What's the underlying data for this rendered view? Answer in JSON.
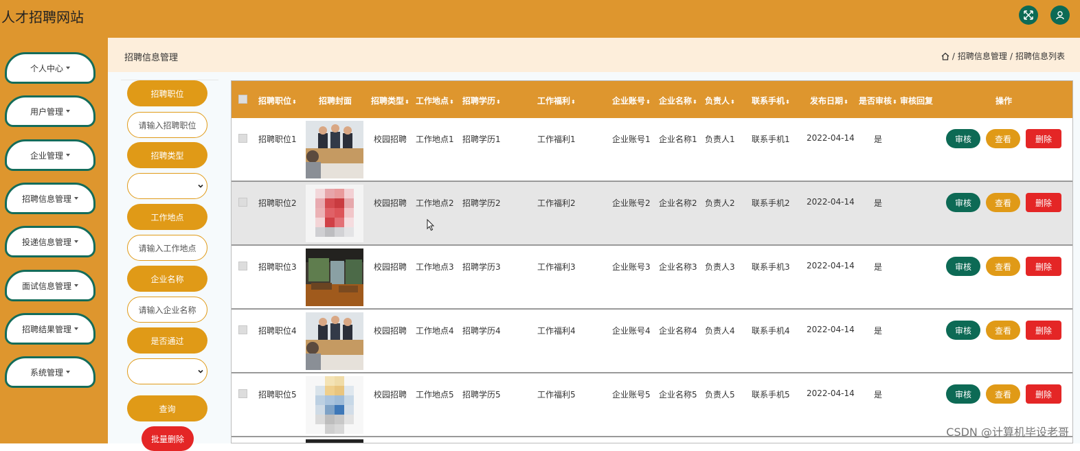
{
  "app": {
    "title": "人才招聘网站"
  },
  "top_icons": [
    "fullscreen-icon",
    "user-icon"
  ],
  "sidebar": {
    "items": [
      {
        "label": "个人中心"
      },
      {
        "label": "用户管理"
      },
      {
        "label": "企业管理"
      },
      {
        "label": "招聘信息管理"
      },
      {
        "label": "投递信息管理"
      },
      {
        "label": "面试信息管理"
      },
      {
        "label": "招聘结果管理"
      },
      {
        "label": "系统管理"
      }
    ]
  },
  "header": {
    "title": "招聘信息管理",
    "breadcrumb": [
      "招聘信息管理",
      "招聘信息列表"
    ]
  },
  "filters": {
    "position_label": "招聘职位",
    "position_placeholder": "请输入招聘职位",
    "type_label": "招聘类型",
    "type_value": "",
    "location_label": "工作地点",
    "location_placeholder": "请输入工作地点",
    "company_label": "企业名称",
    "company_placeholder": "请输入企业名称",
    "approved_label": "是否通过",
    "approved_value": "",
    "search_label": "查询",
    "batch_delete_label": "批量删除"
  },
  "table": {
    "columns": [
      "招聘职位",
      "招聘封面",
      "招聘类型",
      "工作地点",
      "招聘学历",
      "工作福利",
      "企业账号",
      "企业名称",
      "负责人",
      "联系手机",
      "发布日期",
      "是否审核",
      "审核回复",
      "操作"
    ],
    "actions": {
      "review": "审核",
      "view": "查看",
      "delete": "删除"
    },
    "rows": [
      {
        "position": "招聘职位1",
        "cover": "interview-photo",
        "type": "校园招聘",
        "location": "工作地点1",
        "education": "招聘学历1",
        "welfare": "工作福利1",
        "account": "企业账号1",
        "company": "企业名称1",
        "contact": "负责人1",
        "phone": "联系手机1",
        "date": "2022-04-14",
        "audited": "是",
        "reply": ""
      },
      {
        "position": "招聘职位2",
        "cover": "pixelated-red",
        "type": "校园招聘",
        "location": "工作地点2",
        "education": "招聘学历2",
        "welfare": "工作福利2",
        "account": "企业账号2",
        "company": "企业名称2",
        "contact": "负责人2",
        "phone": "联系手机2",
        "date": "2022-04-14",
        "audited": "是",
        "reply": ""
      },
      {
        "position": "招聘职位3",
        "cover": "office-photo",
        "type": "校园招聘",
        "location": "工作地点3",
        "education": "招聘学历3",
        "welfare": "工作福利3",
        "account": "企业账号3",
        "company": "企业名称3",
        "contact": "负责人3",
        "phone": "联系手机3",
        "date": "2022-04-14",
        "audited": "是",
        "reply": ""
      },
      {
        "position": "招聘职位4",
        "cover": "interview-photo",
        "type": "校园招聘",
        "location": "工作地点4",
        "education": "招聘学历4",
        "welfare": "工作福利4",
        "account": "企业账号4",
        "company": "企业名称4",
        "contact": "负责人4",
        "phone": "联系手机4",
        "date": "2022-04-14",
        "audited": "是",
        "reply": ""
      },
      {
        "position": "招聘职位5",
        "cover": "pixelated-blue",
        "type": "校园招聘",
        "location": "工作地点5",
        "education": "招聘学历5",
        "welfare": "工作福利5",
        "account": "企业账号5",
        "company": "企业名称5",
        "contact": "负责人5",
        "phone": "联系手机5",
        "date": "2022-04-14",
        "audited": "是",
        "reply": ""
      }
    ]
  },
  "watermark": "CSDN @计算机毕设老哥",
  "colors": {
    "brand": "#de962e",
    "accent_green": "#0d6a55",
    "danger": "#e42626",
    "header_strip": "#fdeedb"
  }
}
